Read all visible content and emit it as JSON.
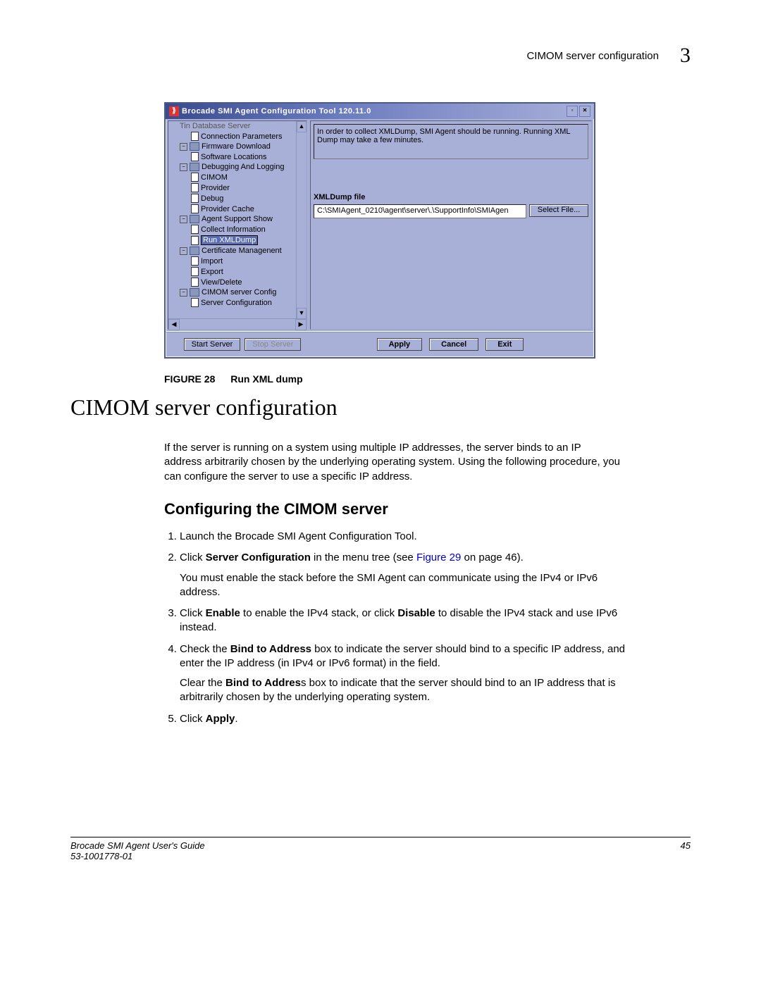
{
  "header": {
    "running": "CIMOM server configuration",
    "chapter": "3"
  },
  "window": {
    "title": "Brocade SMI Agent Configuration Tool 120.11.0",
    "tree": {
      "truncated_top": "Tin Database Server",
      "items": [
        {
          "label": "Connection Parameters",
          "lvl": 2,
          "icon": "file"
        },
        {
          "label": "Firmware Download",
          "lvl": 1,
          "icon": "folder",
          "pm": "−"
        },
        {
          "label": "Software Locations",
          "lvl": 2,
          "icon": "file"
        },
        {
          "label": "Debugging And Logging",
          "lvl": 1,
          "icon": "folder",
          "pm": "−"
        },
        {
          "label": "CIMOM",
          "lvl": 2,
          "icon": "file"
        },
        {
          "label": "Provider",
          "lvl": 2,
          "icon": "file"
        },
        {
          "label": "Debug",
          "lvl": 2,
          "icon": "file"
        },
        {
          "label": "Provider Cache",
          "lvl": 2,
          "icon": "file"
        },
        {
          "label": "Agent Support Show",
          "lvl": 1,
          "icon": "folder",
          "pm": "−"
        },
        {
          "label": "Collect Information",
          "lvl": 2,
          "icon": "file"
        },
        {
          "label": "Run XMLDump",
          "lvl": 2,
          "icon": "file",
          "selected": true
        },
        {
          "label": "Certificate Managenent",
          "lvl": 1,
          "icon": "folder",
          "pm": "−"
        },
        {
          "label": "Import",
          "lvl": 2,
          "icon": "file"
        },
        {
          "label": "Export",
          "lvl": 2,
          "icon": "file"
        },
        {
          "label": "View/Delete",
          "lvl": 2,
          "icon": "file"
        },
        {
          "label": "CIMOM server Config",
          "lvl": 1,
          "icon": "folder",
          "pm": "−"
        },
        {
          "label": "Server Configuration",
          "lvl": 2,
          "icon": "file"
        }
      ]
    },
    "info_text": "In order to collect XMLDump, SMI Agent should be running. Running XML Dump may take a few minutes.",
    "xml_label": "XMLDump file",
    "xml_path": "C:\\SMIAgent_0210\\agent\\server\\.\\SupportInfo\\SMIAgen",
    "select_file": "Select File...",
    "buttons": {
      "start": "Start Server",
      "stop": "Stop Server",
      "apply": "Apply",
      "cancel": "Cancel",
      "exit": "Exit"
    }
  },
  "figure": {
    "label": "FIGURE 28",
    "caption": "Run XML dump"
  },
  "h1": "CIMOM server configuration",
  "para1": "If the server is running on a system using multiple IP addresses, the server binds to an IP address arbitrarily chosen by the underlying operating system. Using the following procedure, you can configure the server to use a specific IP address.",
  "h2": "Configuring the CIMOM server",
  "steps": {
    "s1": "Launch the Brocade SMI Agent Configuration Tool.",
    "s2_a": "Click ",
    "s2_b": "Server Configuration",
    "s2_c": " in the menu tree (see ",
    "s2_link": "Figure 29",
    "s2_d": " on page 46).",
    "s2_sub": "You must enable the stack before the SMI Agent can communicate using the IPv4 or IPv6 address.",
    "s3_a": "Click ",
    "s3_b": "Enable",
    "s3_c": " to enable the IPv4 stack, or click ",
    "s3_d": "Disable",
    "s3_e": " to disable the IPv4 stack and use IPv6 instead.",
    "s4_a": "Check the ",
    "s4_b": "Bind to Address",
    "s4_c": " box to indicate the server should bind to a specific IP address, and enter the IP address (in IPv4 or IPv6 format) in the field.",
    "s4_sub_a": "Clear the ",
    "s4_sub_b": "Bind to Addres",
    "s4_sub_c": "s box to indicate that the server should bind to an IP address that is arbitrarily chosen by the underlying operating system.",
    "s5_a": "Click ",
    "s5_b": "Apply",
    "s5_c": "."
  },
  "footer": {
    "title": "Brocade SMI Agent User's Guide",
    "docnum": "53-1001778-01",
    "page": "45"
  }
}
